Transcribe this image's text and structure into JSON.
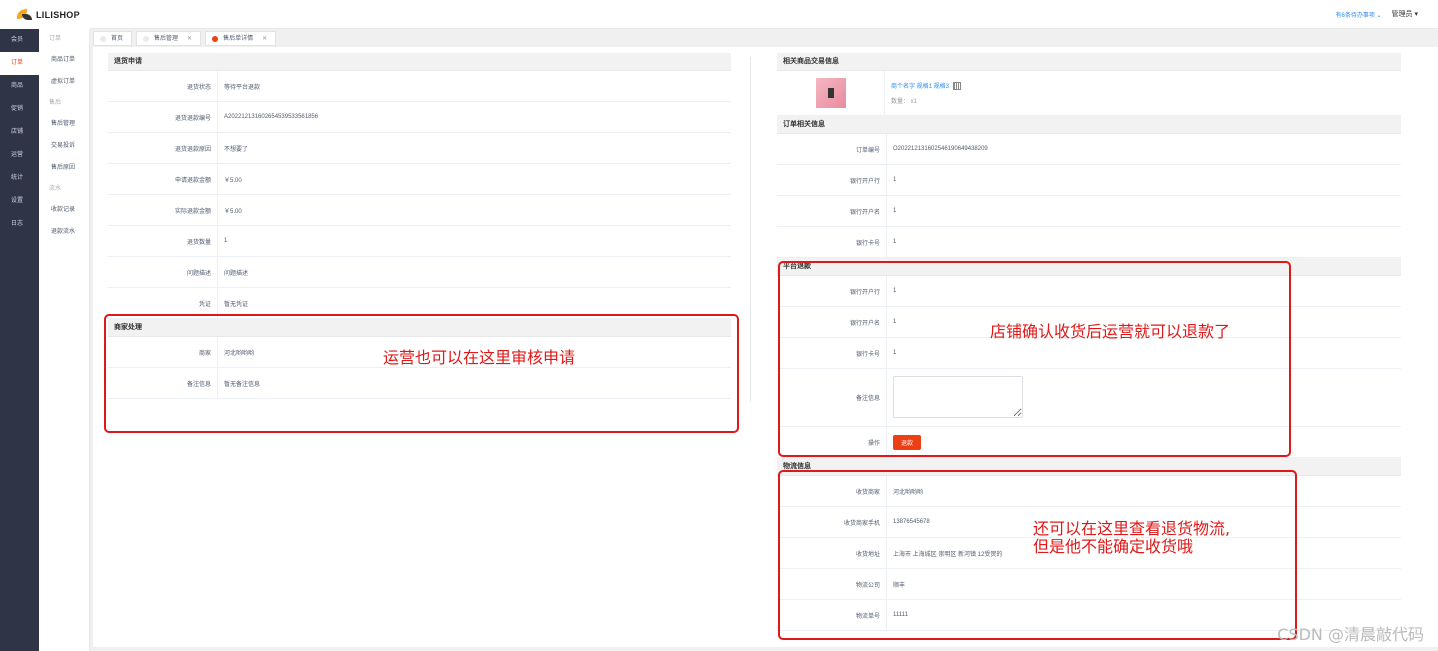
{
  "brand": "LILISHOP",
  "topbar": {
    "todo": "有6条待办事项 ⌄",
    "user": "管理员 ▾"
  },
  "sidebar": [
    {
      "label": "会员"
    },
    {
      "label": "订单"
    },
    {
      "label": "商品"
    },
    {
      "label": "促销"
    },
    {
      "label": "店铺"
    },
    {
      "label": "运营"
    },
    {
      "label": "统计"
    },
    {
      "label": "设置"
    },
    {
      "label": "日志"
    }
  ],
  "subnav": {
    "g1": "订单",
    "g1_items": [
      "商品订单",
      "虚拟订单"
    ],
    "g2": "售后",
    "g2_items": [
      "售后管理",
      "交易投诉",
      "售后原因"
    ],
    "g3": "流水",
    "g3_items": [
      "收款记录",
      "退款流水"
    ]
  },
  "tabs": [
    {
      "label": "首页"
    },
    {
      "label": "售后管理"
    },
    {
      "label": "售后单详情"
    }
  ],
  "left": {
    "refund_title": "退货申请",
    "rows": [
      {
        "label": "退货状态",
        "value": "等待平台退款"
      },
      {
        "label": "退货退款编号",
        "value": "A202212131602654539533561856"
      },
      {
        "label": "退货退款原因",
        "value": "不想要了"
      },
      {
        "label": "申请退款金额",
        "value": "￥5.00"
      },
      {
        "label": "实际退款金额",
        "value": "￥5.00"
      },
      {
        "label": "退货数量",
        "value": "1"
      },
      {
        "label": "问题描述",
        "value": "问题描述"
      },
      {
        "label": "凭证",
        "value": "暂无凭证"
      }
    ],
    "merchant_title": "商家处理",
    "merchant_rows": [
      {
        "label": "商家",
        "value": "河北哟哟哟"
      },
      {
        "label": "备注信息",
        "value": "暂无备注信息"
      }
    ]
  },
  "right": {
    "goods_title": "相关商品交易信息",
    "goods_name": "商个名字 规格1 规格3",
    "goods_qty": "数量： x1",
    "order_title": "订单相关信息",
    "order_rows": [
      {
        "label": "订单编号",
        "value": "O202212131602546190649438209"
      },
      {
        "label": "银行开户行",
        "value": "1"
      },
      {
        "label": "银行开户名",
        "value": "1"
      },
      {
        "label": "银行卡号",
        "value": "1"
      }
    ],
    "platform_title": "平台退款",
    "platform_rows": [
      {
        "label": "银行开户行",
        "value": "1"
      },
      {
        "label": "银行开户名",
        "value": "1"
      },
      {
        "label": "银行卡号",
        "value": "1"
      }
    ],
    "remark_label": "备注信息",
    "op_label": "操作",
    "refund_btn": "退款",
    "logistics_title": "物流信息",
    "logistics_rows": [
      {
        "label": "收货商家",
        "value": "河北哟哟哟"
      },
      {
        "label": "收货商家手机",
        "value": "13876545678"
      },
      {
        "label": "收货地址",
        "value": "上海市 上海城区 崇明区 新河镇 12受贺的"
      },
      {
        "label": "物流公司",
        "value": "顺丰"
      },
      {
        "label": "物流单号",
        "value": "11111"
      }
    ]
  },
  "annotations": {
    "a1": "运营也可以在这里审核申请",
    "a2": "店铺确认收货后运营就可以退款了",
    "a3_line1": "还可以在这里查看退货物流,",
    "a3_line2": "但是他不能确定收货哦"
  },
  "watermark": "CSDN @清晨敲代码",
  "colors": {
    "accent": "#ed3f14",
    "sidebar": "#2f3447",
    "annotation": "#e01818",
    "link": "#2d8cf0"
  }
}
